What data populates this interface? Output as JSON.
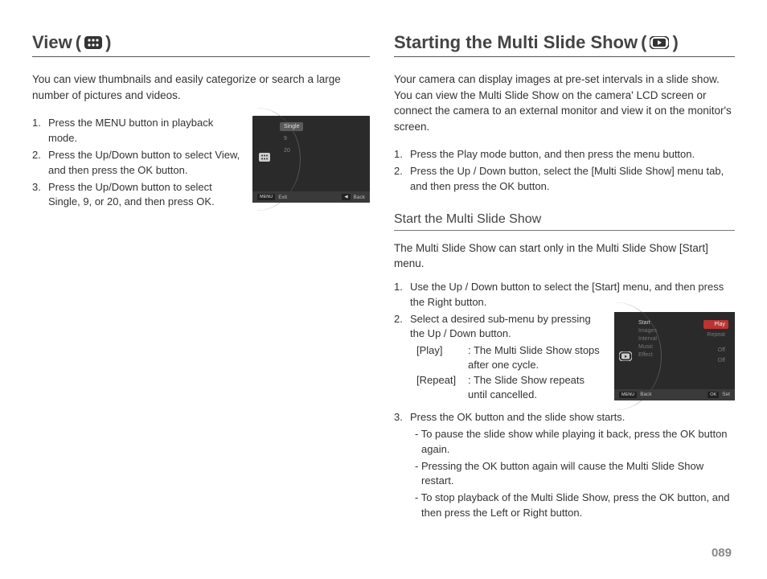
{
  "left": {
    "heading": "View",
    "intro": "You can view thumbnails and easily categorize or search a large number of pictures and videos.",
    "steps": [
      "Press the MENU button in playback mode.",
      "Press the Up/Down button to select View, and then press the OK button.",
      "Press the Up/Down button to select Single, 9, or 20, and then press OK."
    ],
    "lcd": {
      "items": [
        "Single",
        "9",
        "20"
      ],
      "footer_left_key": "MENU",
      "footer_left": "Exit",
      "footer_right_key": "◀",
      "footer_right": "Back"
    }
  },
  "right": {
    "heading": "Starting the Multi Slide Show",
    "intro": "Your camera can display images at pre-set intervals in a slide show. You can view the Multi Slide Show on the camera' LCD screen or connect the camera to an external monitor and view it on the monitor's screen.",
    "pre_steps": [
      "Press the Play mode button, and then press the menu button.",
      "Press the Up / Down button, select the [Multi Slide Show] menu tab, and then press the OK button."
    ],
    "subheading": "Start the Multi Slide Show",
    "sub_intro": "The Multi Slide Show can start only in the Multi Slide Show [Start] menu.",
    "step1": "Use the Up / Down button to select the [Start] menu, and then press the Right button.",
    "step2": "Select a desired sub-menu by pressing the Up / Down button.",
    "def_play_label": "[Play]",
    "def_play_text": ": The Multi Slide Show stops after one cycle.",
    "def_repeat_label": "[Repeat]",
    "def_repeat_text": ": The Slide Show repeats until cancelled.",
    "step3": "Press the OK button and the slide show starts.",
    "step3_a": "- To pause the slide show while playing it back, press the OK button again.",
    "step3_b": "- Pressing the OK button again will cause the Multi Slide Show restart.",
    "step3_c": "- To stop playback of the Multi Slide Show, press the OK button, and then press the Left or Right button.",
    "lcd": {
      "menu": [
        "Start",
        "Images",
        "Interval",
        "Music",
        "Effect"
      ],
      "vals": [
        "Play",
        "Repeat",
        "",
        "Off",
        "Off"
      ],
      "footer_left_key": "MENU",
      "footer_left": "Back",
      "footer_right_key": "OK",
      "footer_right": "Set"
    }
  },
  "page_number": "089"
}
